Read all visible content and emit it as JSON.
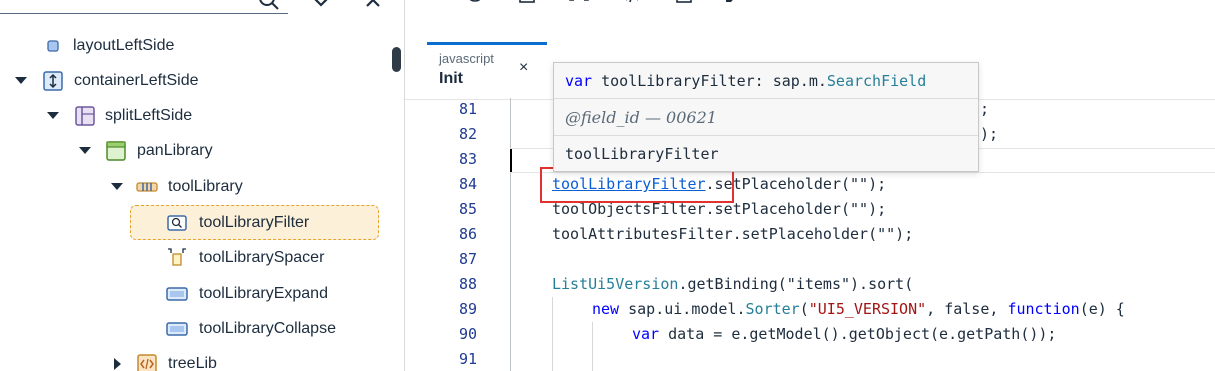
{
  "left_panel": {
    "tree": [
      {
        "label": "layoutLeftSide",
        "icon": "layout-icon",
        "expanded": null
      },
      {
        "label": "containerLeftSide",
        "icon": "container-icon",
        "expanded": true
      },
      {
        "label": "splitLeftSide",
        "icon": "split-icon",
        "expanded": true
      },
      {
        "label": "panLibrary",
        "icon": "panel-icon",
        "expanded": true
      },
      {
        "label": "toolLibrary",
        "icon": "toolbar-icon",
        "expanded": true
      },
      {
        "label": "toolLibraryFilter",
        "icon": "search-field-icon",
        "expanded": null,
        "selected": true
      },
      {
        "label": "toolLibrarySpacer",
        "icon": "spacer-icon",
        "expanded": null
      },
      {
        "label": "toolLibraryExpand",
        "icon": "button-icon",
        "expanded": null
      },
      {
        "label": "toolLibraryCollapse",
        "icon": "button-icon",
        "expanded": null
      },
      {
        "label": "treeLib",
        "icon": "code-icon",
        "expanded": false
      }
    ]
  },
  "editor": {
    "tab": {
      "language": "javascript",
      "title": "Init",
      "close": "×"
    },
    "lines": [
      {
        "n": "81"
      },
      {
        "n": "82"
      },
      {
        "n": "83"
      },
      {
        "n": "84"
      },
      {
        "n": "85"
      },
      {
        "n": "86"
      },
      {
        "n": "87"
      },
      {
        "n": "88"
      },
      {
        "n": "89"
      },
      {
        "n": "90"
      },
      {
        "n": "91"
      }
    ],
    "code": {
      "l81_tail": ";",
      "l82_tail": ");",
      "l84_ident": "toolLibraryFilter",
      "l84_rest": ".setPlaceholder(\"\");",
      "l85": "toolObjectsFilter.setPlaceholder(\"\");",
      "l86": "toolAttributesFilter.setPlaceholder(\"\");",
      "l88_obj": "ListUi5Version",
      "l88_rest": ".getBinding(\"items\").sort(",
      "l89_new": "new",
      "l89_a": " sap.ui.model.",
      "l89_sorter": "Sorter",
      "l89_b": "(",
      "l89_str": "\"UI5_VERSION\"",
      "l89_c": ", false, ",
      "l89_fn": "function",
      "l89_d": "(e) {",
      "l90_var": "var",
      "l90_rest": " data = e.getModel().getObject(e.getPath());"
    },
    "hover": {
      "sig_kw": "var",
      "sig_name": " toolLibraryFilter: sap.m.",
      "sig_type": "SearchField",
      "doc": "@field_id — 00621",
      "name": "toolLibraryFilter"
    }
  },
  "colors": {
    "accent": "#0a6ed1",
    "selection": "#fdf0d9",
    "highlight_box": "#e0332f"
  }
}
